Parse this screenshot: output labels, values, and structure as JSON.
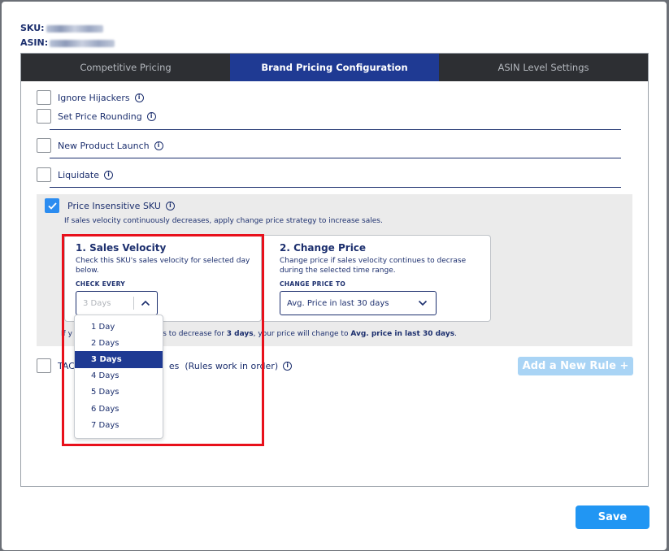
{
  "meta": {
    "sku_label": "SKU:",
    "asin_label": "ASIN:"
  },
  "tabs": [
    "Competitive Pricing",
    "Brand Pricing Configuration",
    "ASIN Level Settings"
  ],
  "options": {
    "ignore_hijackers": "Ignore Hijackers",
    "set_price_rounding": "Set Price Rounding",
    "new_product_launch": "New Product Launch",
    "liquidate": "Liquidate",
    "price_insensitive": "Price Insensitive SKU",
    "price_insensitive_desc": "If sales velocity continuously decreases, apply change price strategy to increase sales.",
    "tacos_prefix": "TAC",
    "tacos_suffix": "es  (Rules work in order)"
  },
  "sales_velocity": {
    "title": "1. Sales Velocity",
    "desc": "Check this SKU's sales velocity for selected day below.",
    "caption": "CHECK EVERY",
    "placeholder": "3 Days"
  },
  "change_price": {
    "title": "2. Change Price",
    "desc": "Change price if sales velocity continues to decrase during the selected time range.",
    "caption": "CHANGE PRICE TO",
    "value": "Avg. Price in last 30 days"
  },
  "result": {
    "prefix": "If y",
    "mid": "ues to decrease for ",
    "days": "3 days",
    "mid2": ", your price will change to ",
    "target": "Avg. price in last 30 days",
    "end": "."
  },
  "add_rule_label": "Add a New Rule +",
  "dropdown_options": [
    "1 Day",
    "2 Days",
    "3 Days",
    "4 Days",
    "5 Days",
    "6 Days",
    "7 Days"
  ],
  "selected_option": "3 Days",
  "save_label": "Save",
  "colors": {
    "accent": "#1f3a93",
    "primary_button": "#2196f3",
    "highlight": "#e8101b",
    "checkbox_checked": "#2b8cf0"
  }
}
